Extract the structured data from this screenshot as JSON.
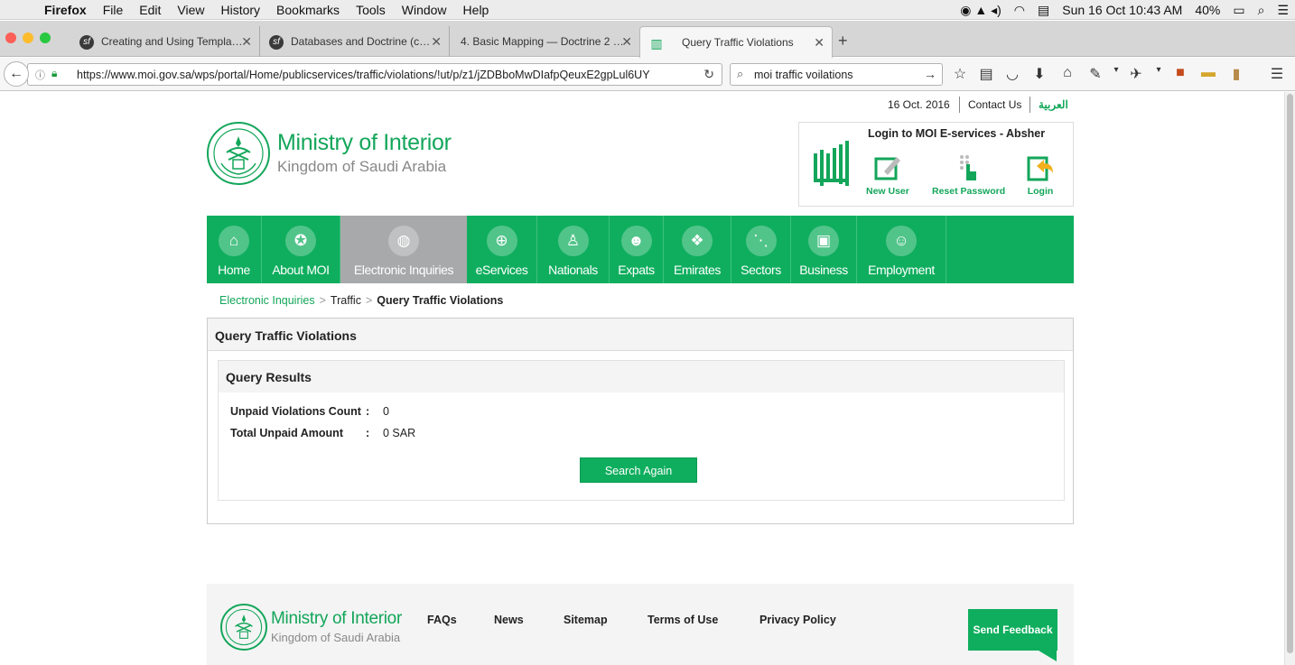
{
  "menubar": {
    "app": "Firefox",
    "items": [
      "File",
      "Edit",
      "View",
      "History",
      "Bookmarks",
      "Tools",
      "Window",
      "Help"
    ],
    "clock": "Sun 16 Oct  10:43 AM",
    "battery": "40%"
  },
  "tabs": [
    {
      "title": "Creating and Using Templa…"
    },
    {
      "title": "Databases and Doctrine (c…"
    },
    {
      "title": "4. Basic Mapping — Doctrine 2 …"
    },
    {
      "title": "Query Traffic Violations"
    }
  ],
  "navbar": {
    "url": "https://www.moi.gov.sa/wps/portal/Home/publicservices/traffic/violations/!ut/p/z1/jZDBboMwDIafpQeuxE2gpLul6UY",
    "search": "moi traffic voilations"
  },
  "page": {
    "date": "16 Oct. 2016",
    "contact": "Contact Us",
    "arabic": "العربية",
    "logo_title": "Ministry of Interior",
    "logo_sub": "Kingdom of Saudi Arabia",
    "absher": {
      "title": "Login to MOI E-services - Absher",
      "actions": [
        "New User",
        "Reset Password",
        "Login"
      ]
    },
    "nav": [
      "Home",
      "About MOI",
      "Electronic Inquiries",
      "eServices",
      "Nationals",
      "Expats",
      "Emirates",
      "Sectors",
      "Business",
      "Employment"
    ],
    "breadcrumb": [
      "Electronic Inquiries",
      "Traffic",
      "Query Traffic Violations"
    ],
    "panel_title": "Query Traffic Violations",
    "results_title": "Query Results",
    "rows": [
      {
        "label": "Unpaid Violations Count",
        "colon": ":",
        "value": "0"
      },
      {
        "label": "Total Unpaid Amount",
        "colon": ":",
        "value": "0 SAR"
      }
    ],
    "search_again": "Search Again",
    "footer": {
      "links": [
        "FAQs",
        "News",
        "Sitemap",
        "Terms of Use",
        "Privacy Policy"
      ],
      "feedback": "Send Feedback"
    }
  }
}
